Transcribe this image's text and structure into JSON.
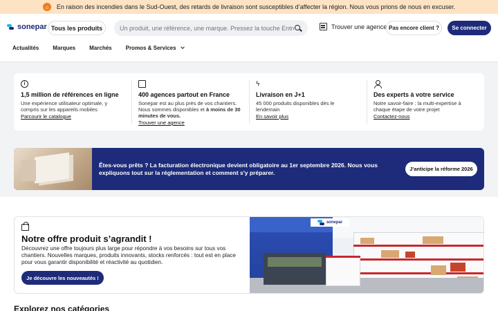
{
  "alert": {
    "icon": "warning-icon",
    "text": "En raison des incendies dans le Sud-Ouest, des retards de livraison sont susceptibles d’affecter la région. Nous vous prions de nous en excuser."
  },
  "header": {
    "logo_text": "sonepar",
    "all_products_label": "Tous les produits",
    "search_placeholder": "Un produit, une référence, une marque. Pressez la touche Entrée",
    "find_agency_label": "Trouver une agence",
    "not_client_label": "Pas encore client ?",
    "login_label": "Se connecter",
    "nav": [
      "Actualités",
      "Marques",
      "Marchés",
      "Promos & Services"
    ]
  },
  "features": [
    {
      "icon": "info-icon",
      "title": "1,5 million de références en ligne",
      "desc": "Une expérience utilisateur optimale, y compris sur les appareils mobiles",
      "desc_bold": "",
      "link": "Parcourir le catalogue"
    },
    {
      "icon": "building-icon",
      "title": "400 agences partout en France",
      "desc": "Sonepar est au plus près de vos chantiers. Nous sommes disponibles et",
      "desc_bold": "à moins de 30 minutes de vous.",
      "link": "Trouver une agence"
    },
    {
      "icon": "lightning-icon",
      "title": "Livraison en J+1",
      "desc": "45 000 produits disponibles dès le lendemain",
      "desc_bold": "",
      "link": "En savoir plus"
    },
    {
      "icon": "person-icon",
      "title": "Des experts à votre service",
      "desc": "Notre savoir-faire : la multi-expertise à chaque étape de votre projet",
      "desc_bold": "",
      "link": "Contactez-nous"
    }
  ],
  "promo": {
    "text": "Êtes-vous prêts ? La facturation électronique devient obligatoire au 1er septembre 2026. Nous vous expliquons tout sur la réglementation et comment s'y préparer.",
    "button": "J'anticipe la réforme 2026"
  },
  "offer": {
    "icon": "shopping-bag-icon",
    "title": "Notre offre produit s’agrandit !",
    "desc": "Découvrez une offre toujours plus large pour répondre à vos besoins sur tous vos chantiers. Nouvelles marques, produits innovants, stocks renforcés : tout est en place pour vous garantir disponibilité et réactivité au quotidien.",
    "button": "Je découvre les nouveautés !",
    "image_sign": "sonepar"
  },
  "next_section": {
    "heading": "Explorez nos catégories"
  },
  "colors": {
    "brand_navy": "#1d2b7a",
    "brand_cyan": "#27b5e6",
    "alert_bg": "#fde3c4",
    "alert_icon": "#f07c1b"
  }
}
